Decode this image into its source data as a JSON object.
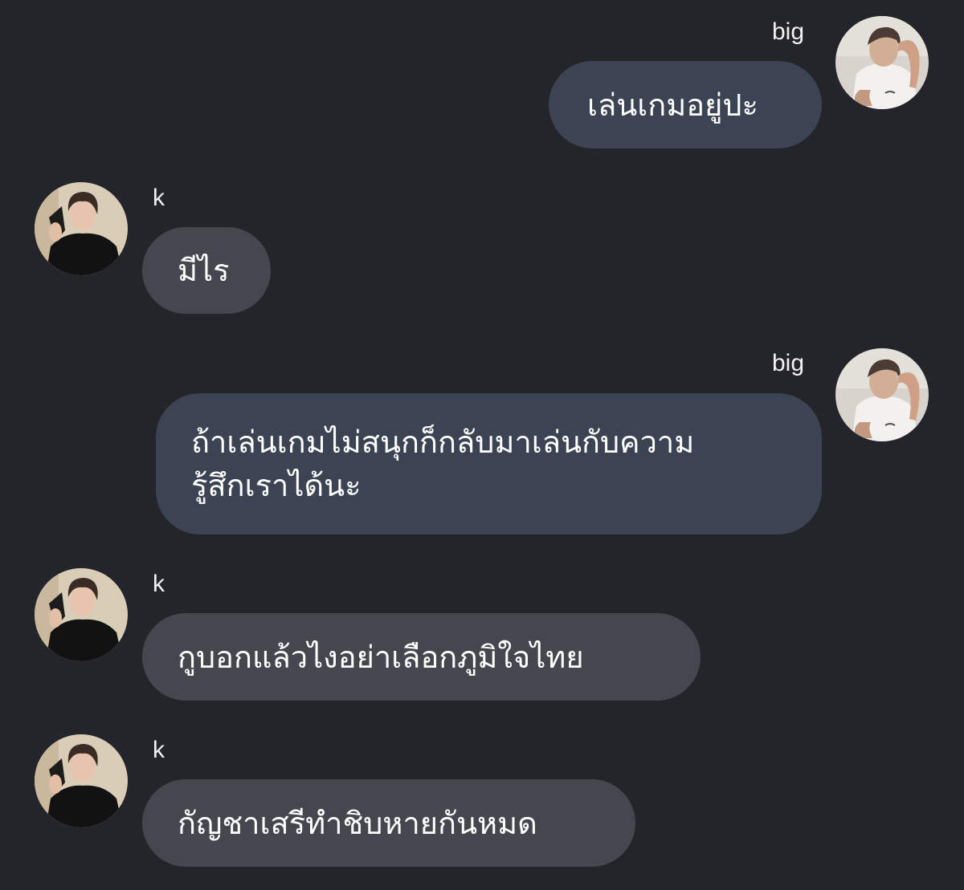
{
  "chat": {
    "messages": [
      {
        "sender": "big",
        "side": "right",
        "text": "เล่นเกมอยู่ปะ"
      },
      {
        "sender": "k",
        "side": "left",
        "text": "มีไร"
      },
      {
        "sender": "big",
        "side": "right",
        "text": "ถ้าเล่นเกมไม่สนุกก็กลับมาเล่นกับความ\nรู้สึกเราได้นะ"
      },
      {
        "sender": "k",
        "side": "left",
        "text": "กูบอกแล้วไงอย่าเลือกภูมิใจไทย"
      },
      {
        "sender": "k",
        "side": "left",
        "text": "กัญชาเสรีทำชิบหายกันหมด"
      }
    ]
  },
  "colors": {
    "background": "#24252b",
    "my_bubble": "#3c4352",
    "their_bubble": "#45474e",
    "text": "#ffffff"
  },
  "icons": {
    "big_avatar": "profile-photo-big",
    "k_avatar": "profile-photo-k"
  }
}
